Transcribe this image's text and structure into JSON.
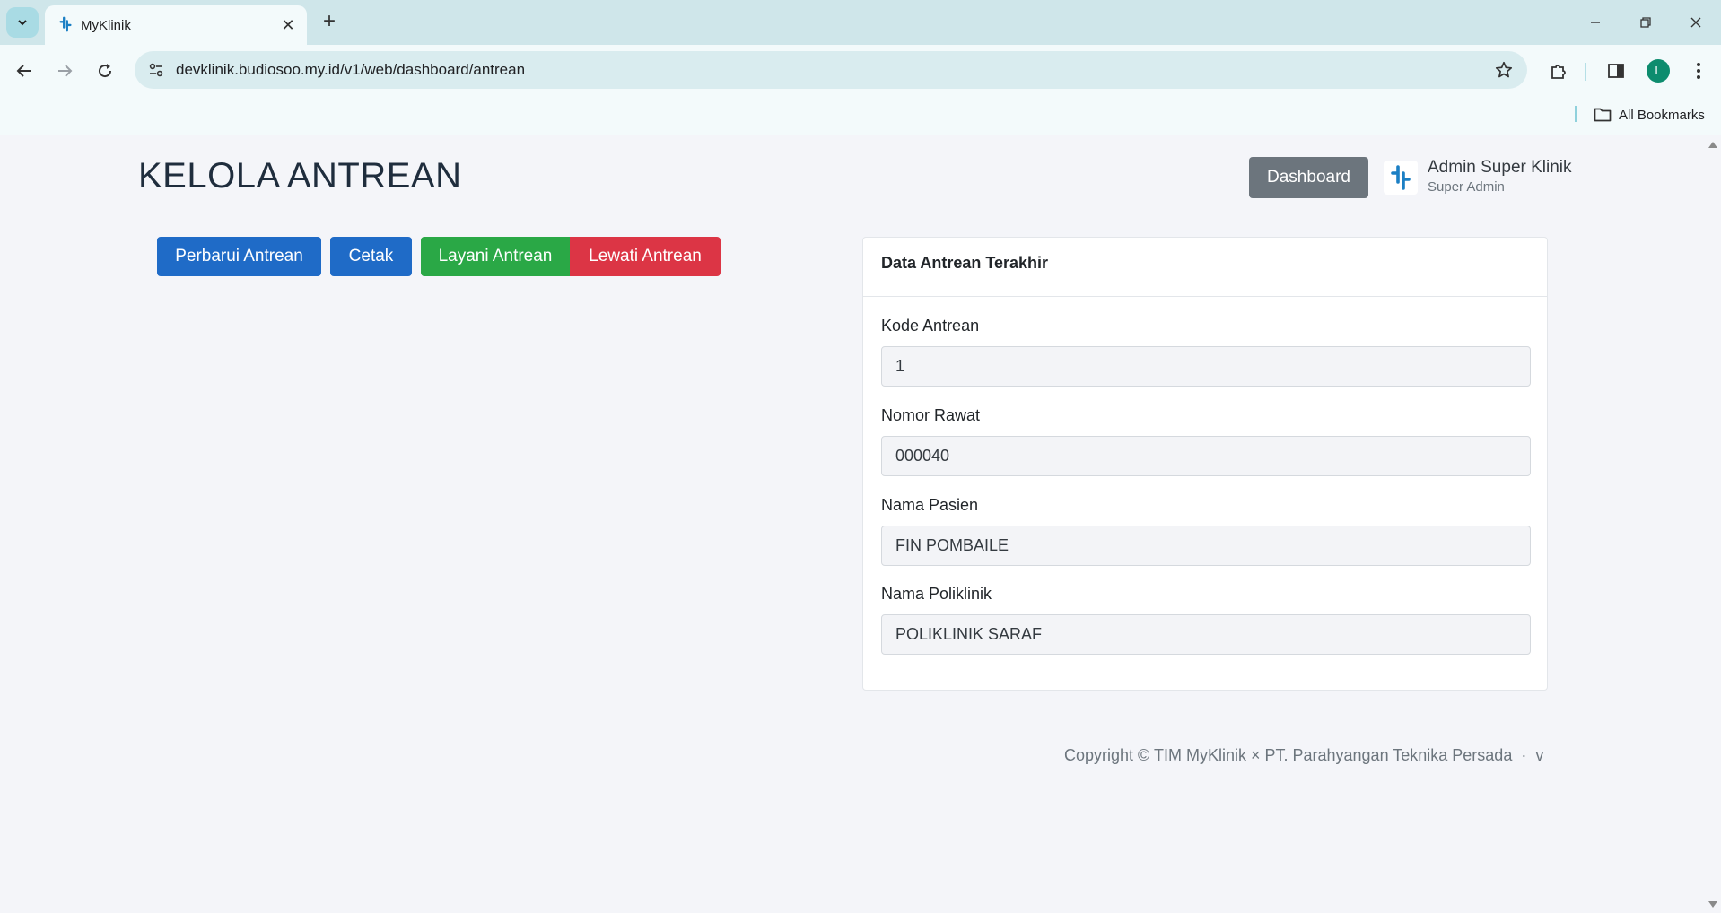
{
  "browser": {
    "tab_title": "MyKlinik",
    "url": "devklinik.budiosoo.my.id/v1/web/dashboard/antrean",
    "profile_initial": "L",
    "bookmarks_label": "All Bookmarks"
  },
  "header": {
    "title": "KELOLA ANTREAN",
    "dashboard_label": "Dashboard",
    "user_name": "Admin Super Klinik",
    "user_role": "Super Admin"
  },
  "actions": {
    "update_label": "Perbarui Antrean",
    "print_label": "Cetak",
    "serve_label": "Layani Antrean",
    "skip_label": "Lewati Antrean"
  },
  "card": {
    "title": "Data Antrean Terakhir",
    "fields": [
      {
        "label": "Kode Antrean",
        "value": "1"
      },
      {
        "label": "Nomor Rawat",
        "value": "000040"
      },
      {
        "label": "Nama Pasien",
        "value": "FIN POMBAILE"
      },
      {
        "label": "Nama Poliklinik",
        "value": "POLIKLINIK SARAF"
      }
    ]
  },
  "footer": {
    "copyright": "Copyright © TIM MyKlinik × PT. Parahyangan Teknika Persada  ·  v"
  },
  "colors": {
    "primary": "#1f6bc7",
    "success": "#2aa846",
    "danger": "#dc3545",
    "secondary": "#6c757d",
    "brand": "#1b7fc4"
  }
}
